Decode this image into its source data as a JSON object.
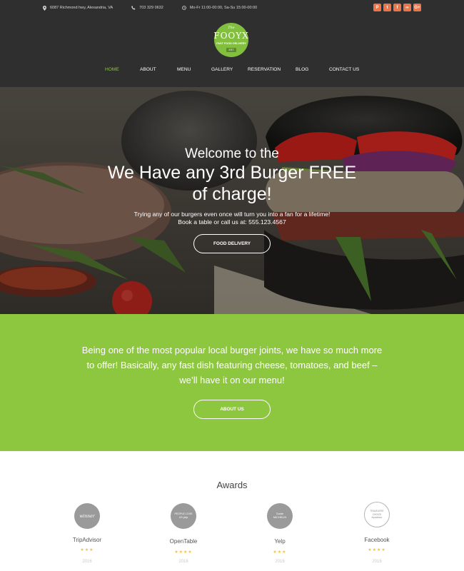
{
  "topbar": {
    "address": "6087 Richmond hwy, Alexandria, VA",
    "phone": "703 329 0632",
    "hours": "Mo-Fr 11:00-00:00, Sa-Su 15:00-00:00",
    "socials": [
      {
        "icon": "pinterest-icon",
        "glyph": "P"
      },
      {
        "icon": "twitter-icon",
        "glyph": "t"
      },
      {
        "icon": "facebook-icon",
        "glyph": "f"
      },
      {
        "icon": "tripadvisor-icon",
        "glyph": "∞"
      },
      {
        "icon": "google-plus-icon",
        "glyph": "G+"
      }
    ],
    "accent_color": "#e9754a"
  },
  "logo": {
    "script": "The",
    "name": "FOOYX",
    "tagline": "FAST FOOD DELIVERY",
    "est": "EST"
  },
  "nav": {
    "items": [
      "HOME",
      "ABOUT",
      "MENU",
      "GALLERY",
      "RESERVATION",
      "BLOG",
      "CONTACT US"
    ],
    "active": "HOME",
    "active_color": "#8ec63f"
  },
  "hero": {
    "subtitle": "Welcome to the",
    "title_line1": "We Have any 3rd Burger FREE",
    "title_line2": "of charge!",
    "text_line1": "Trying any of our burgers even once will turn you into a fan for a lifetime!",
    "text_line2": "Book a table or call us at: 555.123.4567",
    "button": "FOOD DELIVERY"
  },
  "intro": {
    "line1": "Being one of the most popular local burger joints, we have so much more",
    "line2": "to offer! Basically, any fast dish featuring cheese, tomatoes, and beef –",
    "line3": "we’ll have it on our menu!",
    "button": "ABOUT US",
    "background": "#8dc63f"
  },
  "awards": {
    "title": "Awards",
    "items": [
      {
        "name": "TripAdvisor",
        "stars": "★★★",
        "year": "2016",
        "badge_text": "winner"
      },
      {
        "name": "OpenTable",
        "stars": "★★★★",
        "year": "2016",
        "badge_text": "PEOPLE LOVE US yelp"
      },
      {
        "name": "Yelp",
        "stars": "★★★",
        "year": "2016",
        "badge_text": "Guide MICHELIN"
      },
      {
        "name": "Facebook",
        "stars": "★★★★",
        "year": "2016",
        "badge_text": "TRAVELERS' CHOICE tripadvisor"
      }
    ]
  }
}
